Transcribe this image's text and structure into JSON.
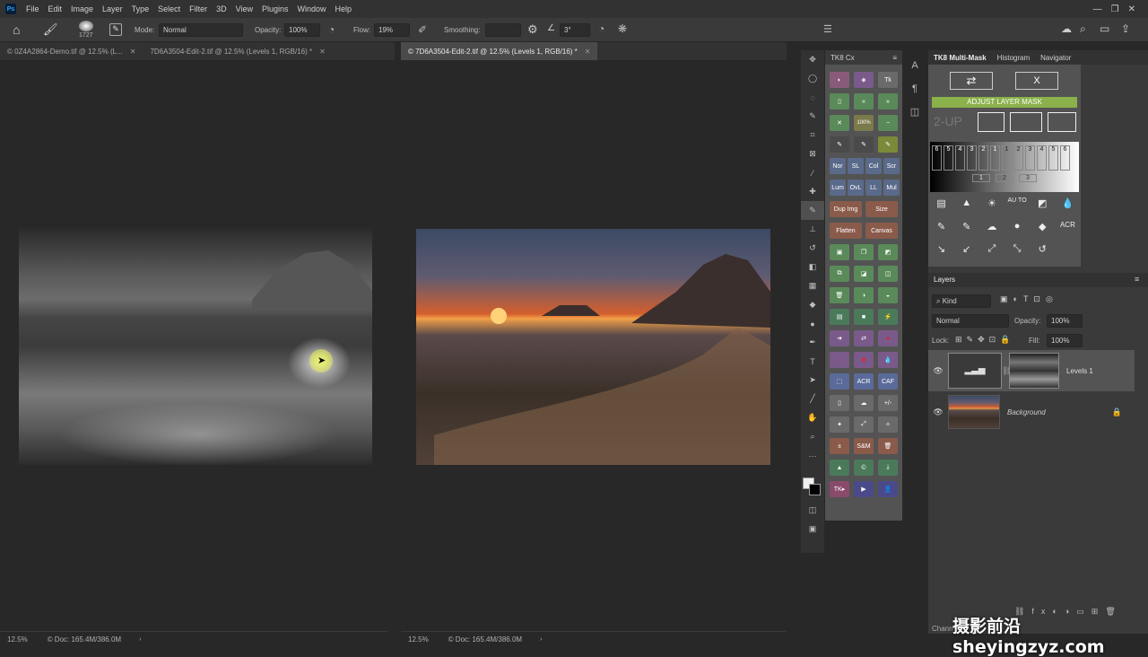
{
  "menubar": {
    "logo": "Ps",
    "items": [
      "File",
      "Edit",
      "Image",
      "Layer",
      "Type",
      "Select",
      "Filter",
      "3D",
      "View",
      "Plugins",
      "Window",
      "Help"
    ]
  },
  "options": {
    "brush_size": "1727",
    "mode_label": "Mode:",
    "mode_value": "Normal",
    "opacity_label": "Opacity:",
    "opacity_value": "100%",
    "flow_label": "Flow:",
    "flow_value": "19%",
    "smoothing_label": "Smoothing:",
    "angle_value": "3°"
  },
  "tabs_left": [
    {
      "label": "© 0Z4A2864-Demo.tif @ 12.5% (L..."
    },
    {
      "label": "7D6A3504-Edit-2.tif @ 12.5% (Levels 1, RGB/16) *"
    }
  ],
  "tab_right": {
    "label": "© 7D6A3504-Edit-2.tif @ 12.5% (Levels 1, RGB/16) *"
  },
  "status_left": {
    "zoom": "12.5%",
    "doc": "© Doc: 165.4M/386.0M"
  },
  "status_right": {
    "zoom": "12.5%",
    "doc": "© Doc: 165.4M/386.0M"
  },
  "tk8": {
    "title": "TK8 Cx",
    "zoom_label": "100%",
    "blend_row1": [
      "Nor",
      "SL",
      "Col",
      "Scr"
    ],
    "blend_row2": [
      "Lum",
      "OvL",
      "LL",
      "Mul"
    ],
    "dup_img": "Dup Img",
    "size": "Size",
    "flatten": "Flatten",
    "canvas": "Canvas",
    "acr": "ACR",
    "caf": "CAF",
    "plusminus": "+/-",
    "sm": "S&M",
    "tk": "TK"
  },
  "multimask": {
    "tabs": [
      "TK8 Multi-Mask",
      "Histogram",
      "Navigator"
    ],
    "x_label": "X",
    "adjust_label": "ADJUST LAYER MASK",
    "two_up": "2-UP",
    "zone_numbers": [
      "6",
      "5",
      "4",
      "3",
      "2",
      "1",
      "1",
      "2",
      "3",
      "4",
      "5",
      "6"
    ],
    "zone_bottom": [
      "1",
      "2",
      "3"
    ],
    "auto_label": "AU TO",
    "acr_label": "ACR"
  },
  "layers": {
    "title": "Layers",
    "kind": "Kind",
    "blend_mode": "Normal",
    "opacity_label": "Opacity:",
    "opacity_value": "100%",
    "lock_label": "Lock:",
    "fill_label": "Fill:",
    "fill_value": "100%",
    "items": [
      {
        "name": "Levels 1"
      },
      {
        "name": "Background"
      }
    ],
    "channels_tab": "Chann"
  },
  "watermark": "摄影前沿 sheyingzyz.com"
}
